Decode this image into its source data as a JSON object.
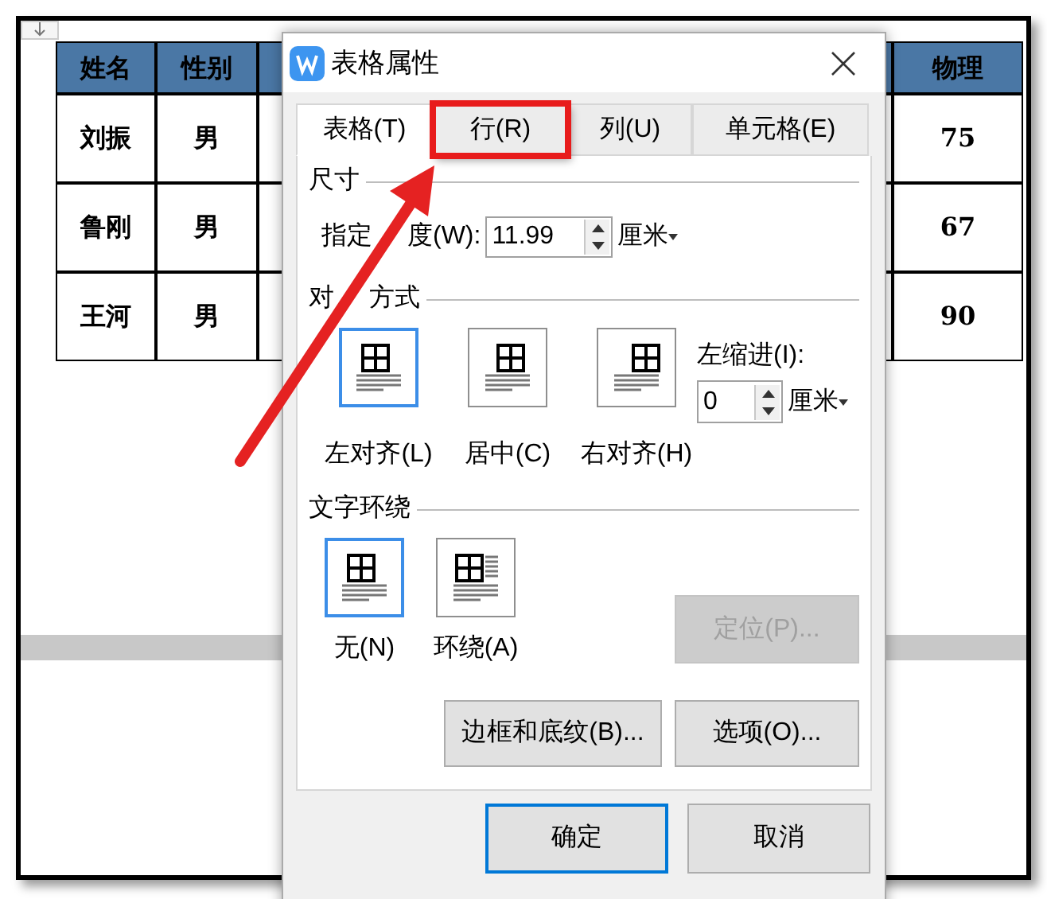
{
  "table": {
    "columns": [
      "姓名",
      "性别",
      "物理"
    ],
    "rows": [
      {
        "name": "刘振",
        "gender": "男",
        "physics": "75"
      },
      {
        "name": "鲁刚",
        "gender": "男",
        "physics": "67"
      },
      {
        "name": "王河",
        "gender": "男",
        "physics": "90"
      }
    ]
  },
  "dialog": {
    "title": "表格属性",
    "tabs": [
      {
        "label": "表格(T)",
        "selected": true,
        "highlighted": false
      },
      {
        "label": "行(R)",
        "selected": false,
        "highlighted": true
      },
      {
        "label": "列(U)",
        "selected": false,
        "highlighted": false
      },
      {
        "label": "单元格(E)",
        "selected": false,
        "highlighted": false
      }
    ],
    "size": {
      "heading": "尺寸",
      "width_label_parts": [
        "指定",
        "度(W):"
      ],
      "width_value": "11.99",
      "unit": "厘米"
    },
    "alignment": {
      "heading_parts": [
        "对",
        "方式"
      ],
      "options": [
        {
          "kind": "left",
          "label": "左对齐(L)",
          "selected": true
        },
        {
          "kind": "center",
          "label": "居中(C)",
          "selected": false
        },
        {
          "kind": "right",
          "label": "右对齐(H)",
          "selected": false
        }
      ],
      "indent_label": "左缩进(I):",
      "indent_value": "0",
      "unit": "厘米"
    },
    "wrapping": {
      "heading": "文字环绕",
      "options": [
        {
          "kind": "none",
          "label": "无(N)",
          "selected": true
        },
        {
          "kind": "around",
          "label": "环绕(A)",
          "selected": false
        }
      ],
      "position_button": {
        "label": "定位(P)...",
        "disabled": true
      }
    },
    "buttons": [
      "边框和底纹(B)...",
      "选项(O)..."
    ],
    "footer_buttons": [
      {
        "label": "确定",
        "default": true
      },
      {
        "label": "取消",
        "default": false
      }
    ]
  }
}
